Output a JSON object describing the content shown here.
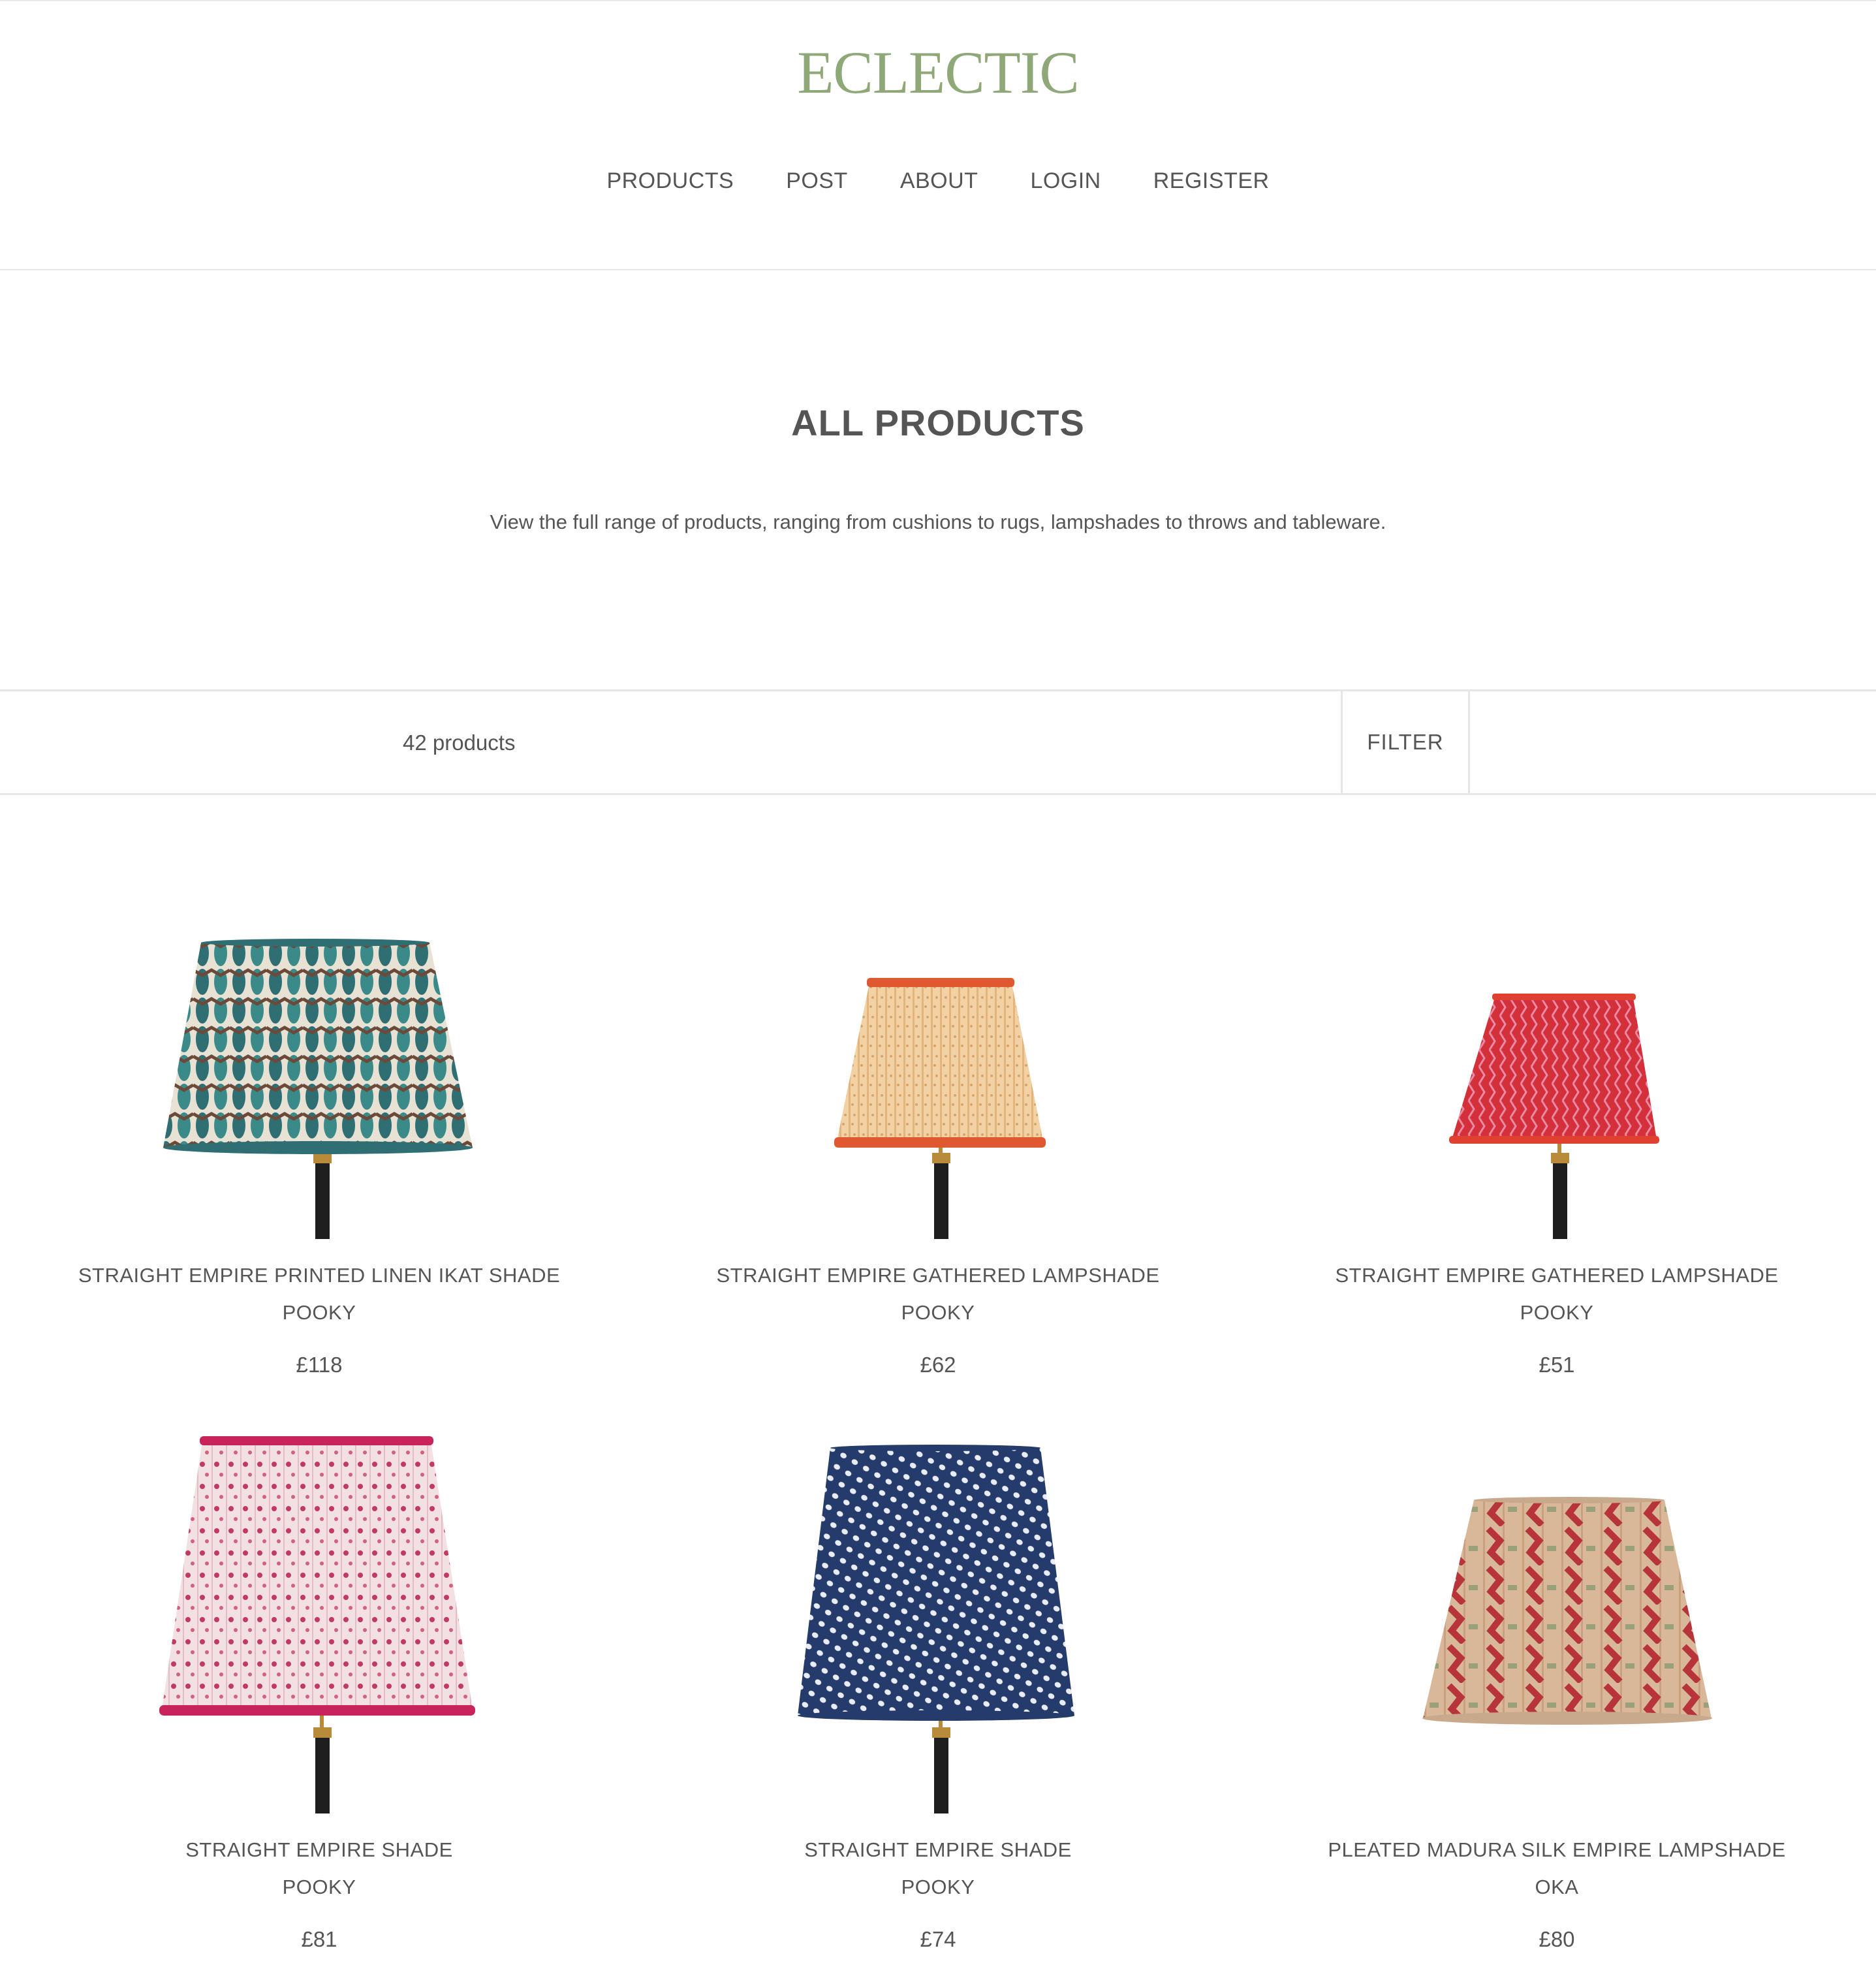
{
  "header": {
    "logo": "ECLECTIC",
    "logo_color": "#8fa877",
    "nav": [
      {
        "label": "PRODUCTS"
      },
      {
        "label": "POST"
      },
      {
        "label": "ABOUT"
      },
      {
        "label": "LOGIN"
      },
      {
        "label": "REGISTER"
      }
    ]
  },
  "intro": {
    "title": "ALL PRODUCTS",
    "description": "View the full range of products, ranging from cushions to rugs, lampshades to throws and tableware."
  },
  "toolbar": {
    "count_label": "42 products",
    "filter_label": "FILTER"
  },
  "products": [
    {
      "name": "STRAIGHT EMPIRE PRINTED LINEN IKAT SHADE",
      "brand": "POOKY",
      "price": "£118",
      "shade_color": "#2f6f74",
      "accent_color": "#6b4a3a",
      "trim_color": "#2f6f74",
      "image": "ikat-lampshade-icon"
    },
    {
      "name": "STRAIGHT EMPIRE GATHERED LAMPSHADE",
      "brand": "POOKY",
      "price": "£62",
      "shade_color": "#f2d2a4",
      "accent_color": "#d9a56a",
      "trim_color": "#e0582f",
      "image": "gathered-lampshade-icon"
    },
    {
      "name": "STRAIGHT EMPIRE GATHERED LAMPSHADE",
      "brand": "POOKY",
      "price": "£51",
      "shade_color": "#d4303a",
      "accent_color": "#e88aa6",
      "trim_color": "#e0402f",
      "image": "gathered-lampshade-icon"
    },
    {
      "name": "STRAIGHT EMPIRE SHADE",
      "brand": "POOKY",
      "price": "£81",
      "shade_color": "#f3e0e3",
      "accent_color": "#c23a60",
      "trim_color": "#c8235a",
      "image": "floral-lampshade-icon"
    },
    {
      "name": "STRAIGHT EMPIRE SHADE",
      "brand": "POOKY",
      "price": "£74",
      "shade_color": "#243b6b",
      "accent_color": "#e9ecf3",
      "trim_color": "#243b6b",
      "image": "pattern-lampshade-icon"
    },
    {
      "name": "PLEATED MADURA SILK EMPIRE LAMPSHADE",
      "brand": "OKA",
      "price": "£80",
      "shade_color": "#d9b89a",
      "accent_color": "#b8343b",
      "trim_color": "#c9a98c",
      "image": "silk-lampshade-icon"
    }
  ]
}
